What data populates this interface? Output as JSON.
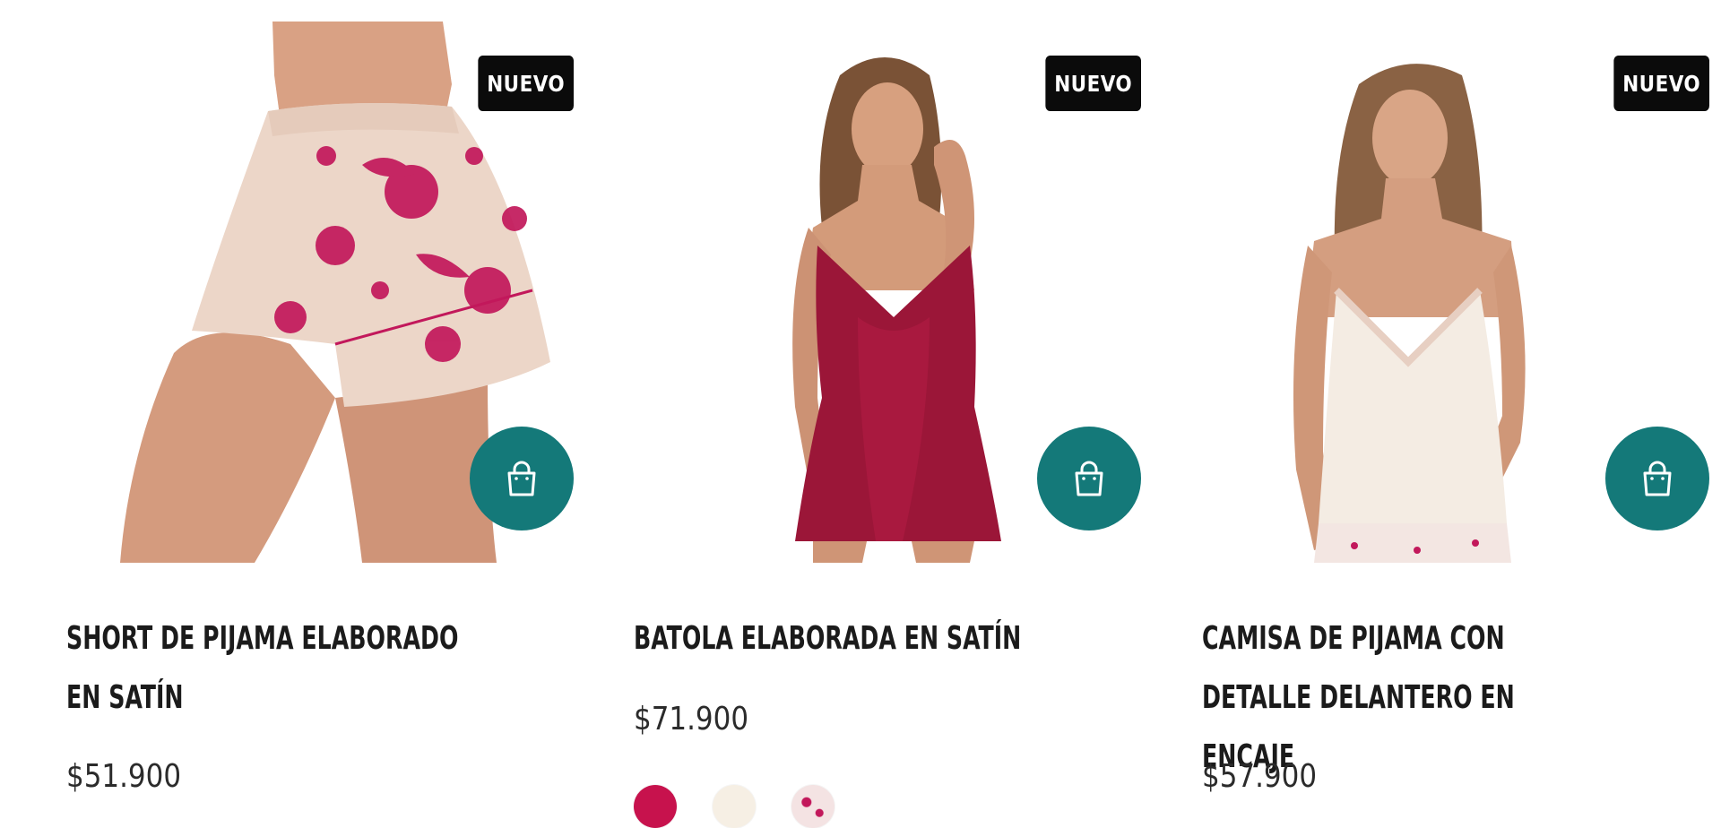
{
  "products": [
    {
      "badge": "NUEVO",
      "title": "SHORT DE PIJAMA ELABORADO EN SATÍN",
      "price": "$51.900",
      "image": "woman-in-floral-satin-pajama-shorts"
    },
    {
      "badge": "NUEVO",
      "title": "BATOLA ELABORADA EN SATÍN",
      "price": "$71.900",
      "image": "woman-in-burgundy-satin-slip-dress",
      "swatches": [
        {
          "name": "burgundy",
          "color": "#c7124d"
        },
        {
          "name": "ivory",
          "color": "#f6efe4"
        },
        {
          "name": "floral-print",
          "color": "#f4e3e3"
        }
      ]
    },
    {
      "badge": "NUEVO",
      "title": "CAMISA DE PIJAMA CON DETALLE DELANTERO EN ENCAJE",
      "price": "$57.900",
      "image": "woman-in-ivory-satin-camisole-with-lace"
    }
  ],
  "colors": {
    "cart_button": "#147979",
    "badge_bg": "#0b0b0b"
  },
  "icons": {
    "cart": "shopping-bag-icon"
  }
}
